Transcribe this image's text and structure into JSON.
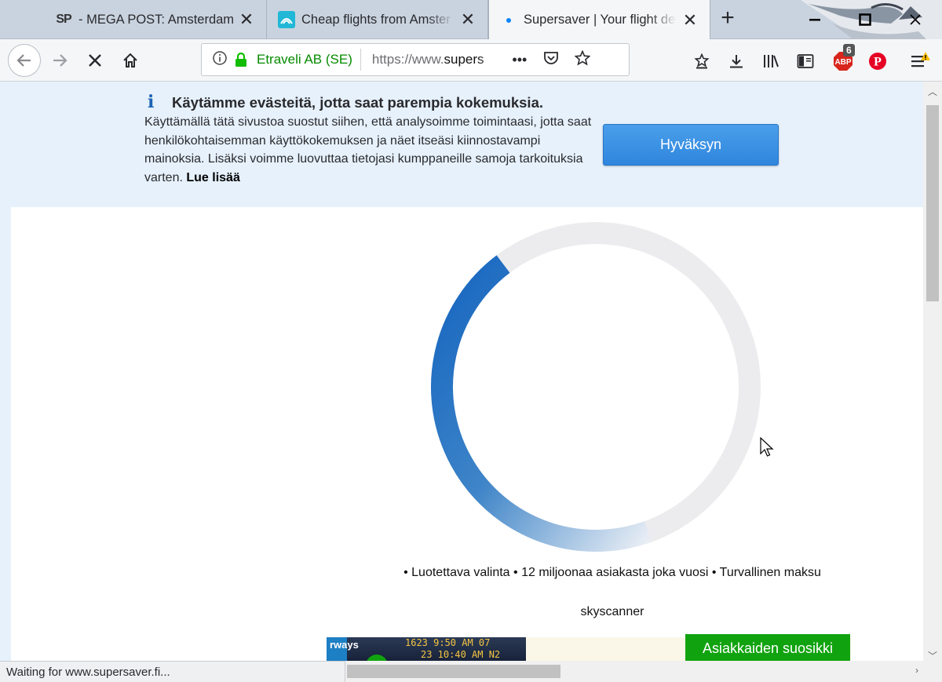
{
  "tabs": [
    {
      "favicon": "SP",
      "title": "- MEGA POST: Amsterdam",
      "active": false
    },
    {
      "favicon": "skyscanner-icon",
      "title": "Cheap flights from Amster",
      "active": false
    },
    {
      "favicon": "loading-dot",
      "title": "Supersaver | Your flight det",
      "active": true
    }
  ],
  "window_controls": {
    "minimize": "minimize-icon",
    "maximize": "maximize-icon",
    "close": "close-icon"
  },
  "urlbar": {
    "identity": "Etraveli AB (SE)",
    "url_prefix": "https://www.",
    "url_host": "supers"
  },
  "toolbar": {
    "abp_badge": "6",
    "icons": [
      "bookmarks-star-icon",
      "download-icon",
      "library-icon",
      "sidebar-icon",
      "adblock-icon",
      "pinterest-icon",
      "menu-icon"
    ]
  },
  "cookie_banner": {
    "title": "Käytämme evästeitä, jotta saat parempia kokemuksia.",
    "text": "Käyttämällä tätä sivustoa suostut siihen, että analysoimme toimintaasi, jotta saat henkilökohtaisemman käyttökokemuksen ja näet itseäsi kiinnostavampi mainoksia. Lisäksi voimme luovuttaa tietojasi kumppaneille samoja tarkoituksia varten.",
    "read_more": "Lue lisää",
    "accept_label": "Hyväksyn"
  },
  "loading": {
    "progress_fraction": 0.13
  },
  "taglines": "• Luotettava valinta • 12 miljoonaa asiakasta joka vuosi • Turvallinen maksu",
  "partner_label": "skyscanner",
  "banner": {
    "board_text": "rways",
    "row1": "1623   9:50 AM  07",
    "row2": "23   10:40 AM  N2",
    "badge": "Asiakkaiden suosikki"
  },
  "status": "Waiting for www.supersaver.fi...",
  "colors": {
    "accent": "#2f86dd",
    "spinner": "#1565c0",
    "identity": "#058b00",
    "badge_green": "#11a30f"
  }
}
